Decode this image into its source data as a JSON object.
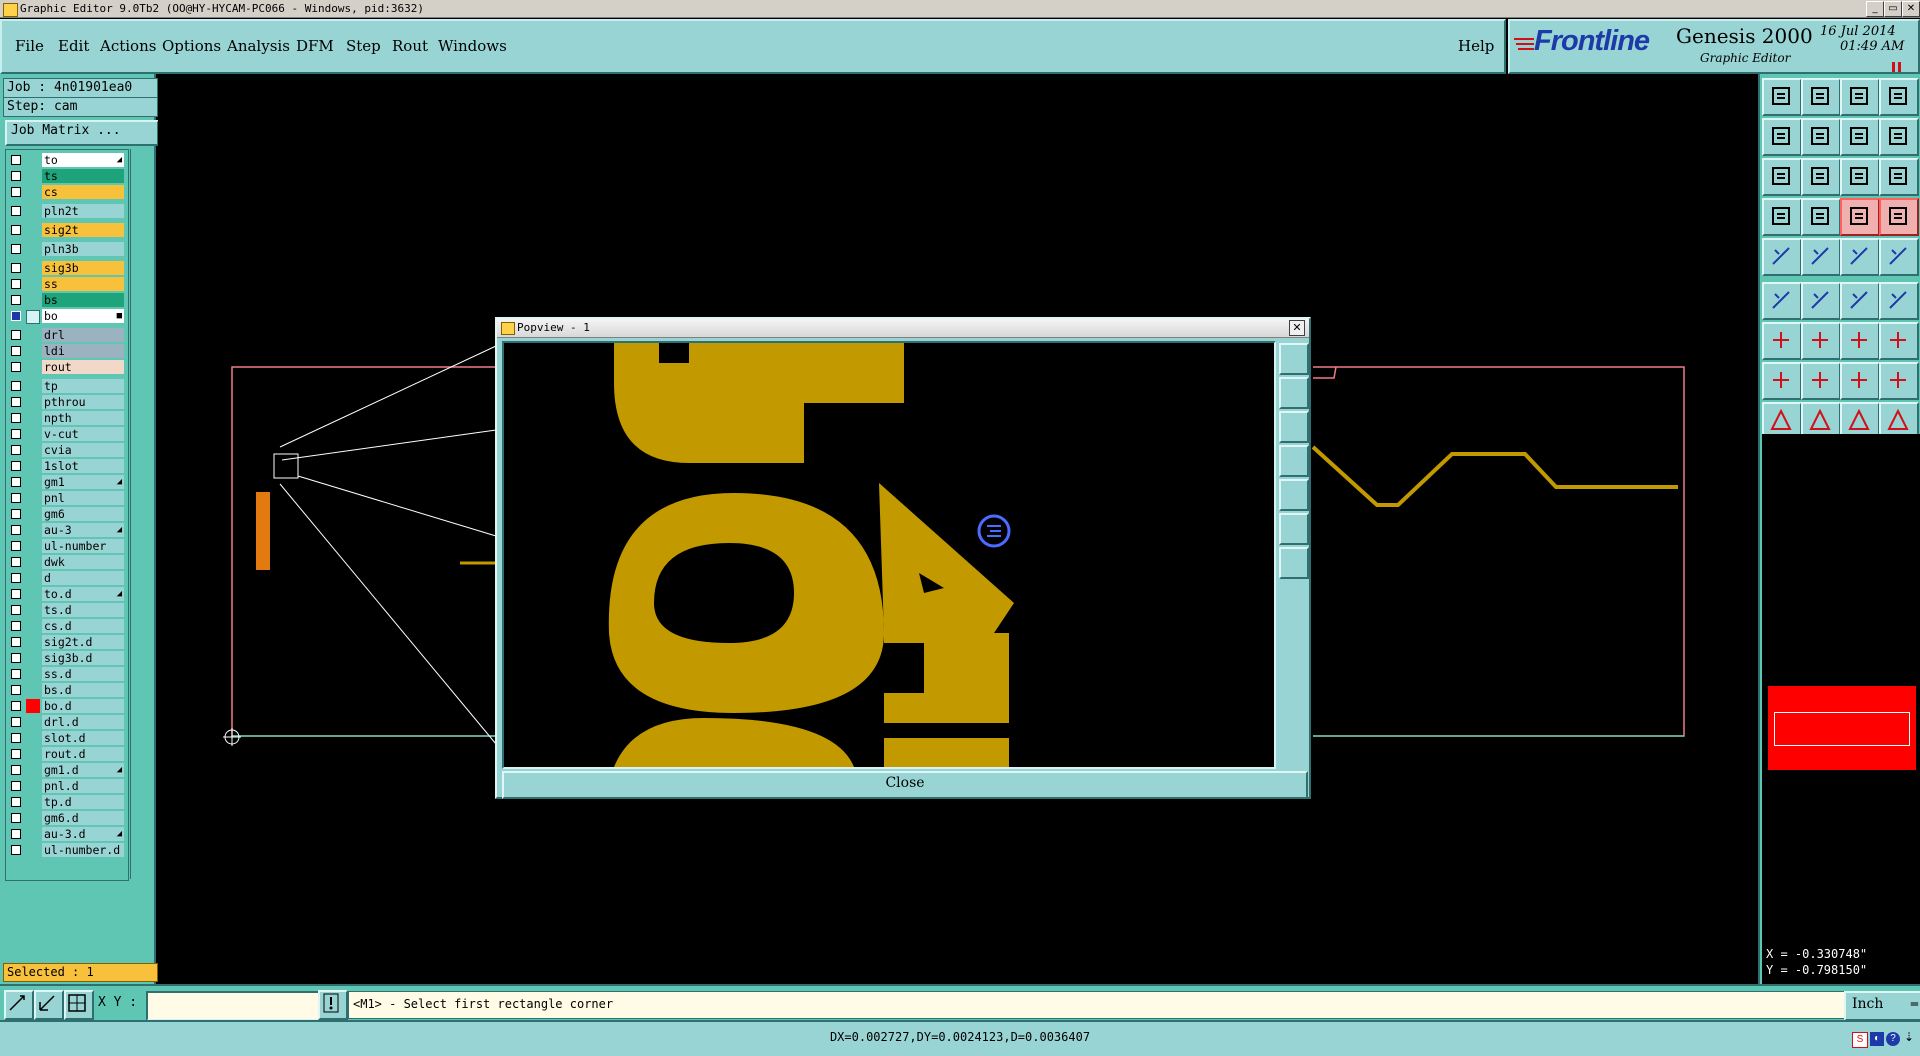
{
  "window": {
    "title": "Graphic Editor 9.0Tb2 (OO@HY-HYCAM-PC066 - Windows, pid:3632)",
    "controls": [
      "_",
      "▭",
      "✕"
    ]
  },
  "menu": {
    "items": [
      "File",
      "Edit",
      "Actions",
      "Options",
      "Analysis",
      "DFM",
      "Step",
      "Rout",
      "Windows"
    ],
    "help": "Help"
  },
  "brand": {
    "logo": "Frontline",
    "product": "Genesis 2000",
    "subtitle": "Graphic Editor",
    "date": "16 Jul 2014",
    "time": "01:49 AM"
  },
  "job": {
    "job_label": "Job : 4n01901ea0",
    "step_label": "Step: cam",
    "matrix_button": "Job Matrix ..."
  },
  "layers": [
    {
      "name": "to",
      "color": "#ffffff",
      "mark": "◢"
    },
    {
      "name": "ts",
      "color": "#1fa37a"
    },
    {
      "name": "cs",
      "color": "#f7c13c"
    },
    {
      "name": "pln2t",
      "color": "#99d4d4",
      "gap": true
    },
    {
      "name": "sig2t",
      "color": "#f7c13c",
      "gap": true
    },
    {
      "name": "pln3b",
      "color": "#99d4d4",
      "gap": true
    },
    {
      "name": "sig3b",
      "color": "#f7c13c",
      "gap": true
    },
    {
      "name": "ss",
      "color": "#f7c13c"
    },
    {
      "name": "bs",
      "color": "#1fa37a"
    },
    {
      "name": "bo",
      "color": "#ffffff",
      "active": true,
      "mark": "■"
    },
    {
      "name": "drl",
      "color": "#9bb3c0",
      "gap": true
    },
    {
      "name": "ldi",
      "color": "#9bb3c0"
    },
    {
      "name": "rout",
      "color": "#f2d8c8"
    },
    {
      "name": "tp",
      "color": "#99d4d4",
      "gap": true
    },
    {
      "name": "pthrou",
      "color": "#99d4d4"
    },
    {
      "name": "npth",
      "color": "#99d4d4"
    },
    {
      "name": "v-cut",
      "color": "#99d4d4"
    },
    {
      "name": "cvia",
      "color": "#99d4d4"
    },
    {
      "name": "1slot",
      "color": "#99d4d4"
    },
    {
      "name": "gm1",
      "color": "#99d4d4",
      "mark": "◢"
    },
    {
      "name": "pnl",
      "color": "#99d4d4"
    },
    {
      "name": "gm6",
      "color": "#99d4d4"
    },
    {
      "name": "au-3",
      "color": "#99d4d4",
      "mark": "◢"
    },
    {
      "name": "ul-number",
      "color": "#99d4d4"
    },
    {
      "name": "dwk",
      "color": "#99d4d4"
    },
    {
      "name": "d",
      "color": "#99d4d4"
    },
    {
      "name": "to.d",
      "color": "#99d4d4",
      "mark": "◢"
    },
    {
      "name": "ts.d",
      "color": "#99d4d4"
    },
    {
      "name": "cs.d",
      "color": "#99d4d4"
    },
    {
      "name": "sig2t.d",
      "color": "#99d4d4"
    },
    {
      "name": "sig3b.d",
      "color": "#99d4d4"
    },
    {
      "name": "ss.d",
      "color": "#99d4d4"
    },
    {
      "name": "bs.d",
      "color": "#99d4d4"
    },
    {
      "name": "bo.d",
      "color": "#99d4d4",
      "flag": "#ff0000"
    },
    {
      "name": "drl.d",
      "color": "#99d4d4"
    },
    {
      "name": "slot.d",
      "color": "#99d4d4"
    },
    {
      "name": "rout.d",
      "color": "#99d4d4"
    },
    {
      "name": "gm1.d",
      "color": "#99d4d4",
      "mark": "◢"
    },
    {
      "name": "pnl.d",
      "color": "#99d4d4"
    },
    {
      "name": "tp.d",
      "color": "#99d4d4"
    },
    {
      "name": "gm6.d",
      "color": "#99d4d4"
    },
    {
      "name": "au-3.d",
      "color": "#99d4d4",
      "mark": "◢"
    },
    {
      "name": "ul-number.d",
      "color": "#99d4d4"
    }
  ],
  "selected": "Selected : 1",
  "popview": {
    "title": "Popview - 1",
    "close_label": "Close"
  },
  "coords": {
    "x": "X = -0.330748\"",
    "y": "Y = -0.798150\""
  },
  "bottom": {
    "xy_label": "X Y :",
    "xy_value": "",
    "prompt": "<M1> - Select first rectangle corner",
    "units": "Inch"
  },
  "status": {
    "message": "DX=0.002727,DY=0.0024123,D=0.0036407"
  },
  "colors": {
    "panel": "#5ec6b3",
    "button": "#99d4d4",
    "artwork_gold": "#c29a00",
    "profile_red": "#f07a8a",
    "highlight_red": "#ff0000"
  }
}
